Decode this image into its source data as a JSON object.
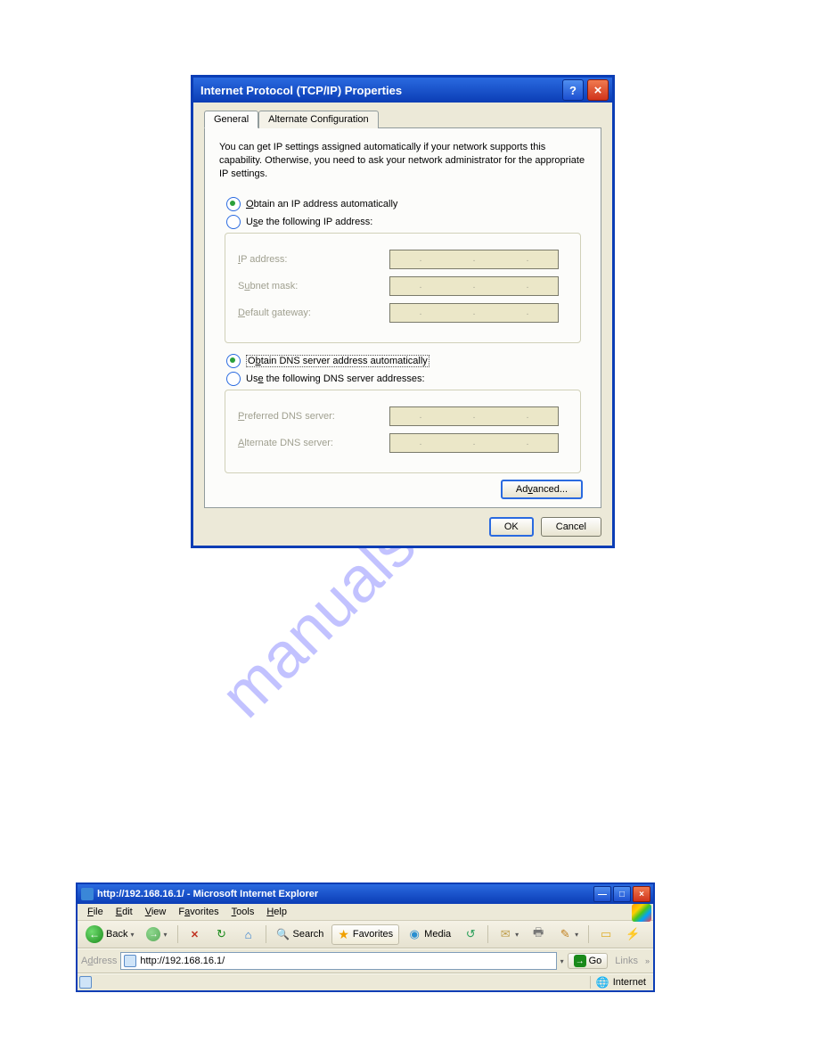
{
  "dialog1": {
    "title": "Internet Protocol (TCP/IP) Properties",
    "tabs": [
      "General",
      "Alternate Configuration"
    ],
    "description": "You can get IP settings assigned automatically if your network supports this capability. Otherwise, you need to ask your network administrator for the appropriate IP settings.",
    "radio_auto_ip": "Obtain an IP address automatically",
    "radio_manual_ip": "Use the following IP address:",
    "ip_address_label": "IP address:",
    "subnet_label": "Subnet mask:",
    "gateway_label": "Default gateway:",
    "radio_auto_dns": "Obtain DNS server address automatically",
    "radio_manual_dns": "Use the following DNS server addresses:",
    "pref_dns_label": "Preferred DNS server:",
    "alt_dns_label": "Alternate DNS server:",
    "advanced_btn": "Advanced...",
    "ok_btn": "OK",
    "cancel_btn": "Cancel"
  },
  "ie": {
    "title": "http://192.168.16.1/ - Microsoft Internet Explorer",
    "menu": {
      "file": "File",
      "edit": "Edit",
      "view": "View",
      "favorites": "Favorites",
      "tools": "Tools",
      "help": "Help"
    },
    "tb": {
      "back": "Back",
      "search": "Search",
      "favorites": "Favorites",
      "media": "Media"
    },
    "addr_label": "Address",
    "addr_value": "http://192.168.16.1/",
    "go": "Go",
    "links": "Links",
    "status_zone": "Internet"
  },
  "watermark": "manualshive.com"
}
